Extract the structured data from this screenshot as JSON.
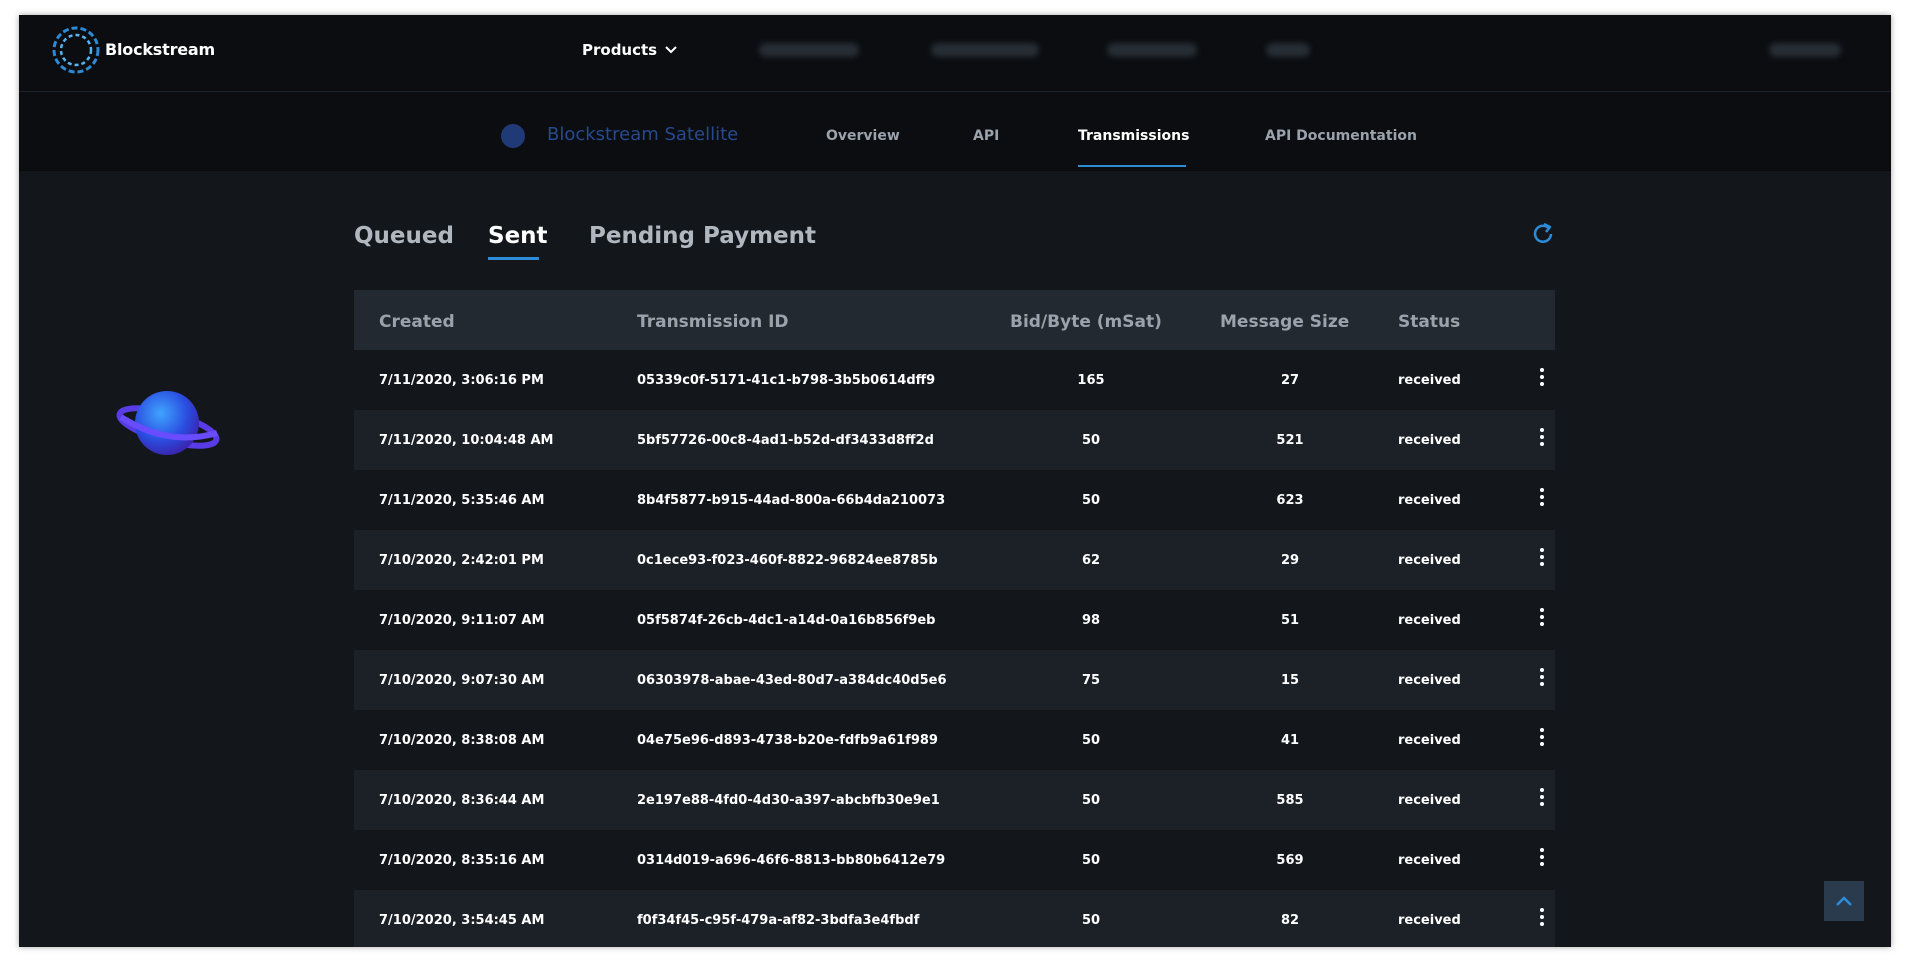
{
  "brand": {
    "name": "Blockstream"
  },
  "topnav": {
    "products_label": "Products"
  },
  "subnav": {
    "title": "Blockstream Satellite",
    "tabs": [
      "Overview",
      "API",
      "Transmissions",
      "API Documentation"
    ],
    "active_tab": "Transmissions"
  },
  "tabs": {
    "items": [
      "Queued",
      "Sent",
      "Pending Payment"
    ],
    "active": "Sent"
  },
  "table": {
    "headers": [
      "Created",
      "Transmission ID",
      "Bid/Byte (mSat)",
      "Message Size",
      "Status"
    ],
    "rows": [
      [
        "7/11/2020, 3:06:16 PM",
        "05339c0f-5171-41c1-b798-3b5b0614dff9",
        "165",
        "27",
        "received"
      ],
      [
        "7/11/2020, 10:04:48 AM",
        "5bf57726-00c8-4ad1-b52d-df3433d8ff2d",
        "50",
        "521",
        "received"
      ],
      [
        "7/11/2020, 5:35:46 AM",
        "8b4f5877-b915-44ad-800a-66b4da210073",
        "50",
        "623",
        "received"
      ],
      [
        "7/10/2020, 2:42:01 PM",
        "0c1ece93-f023-460f-8822-96824ee8785b",
        "62",
        "29",
        "received"
      ],
      [
        "7/10/2020, 9:11:07 AM",
        "05f5874f-26cb-4dc1-a14d-0a16b856f9eb",
        "98",
        "51",
        "received"
      ],
      [
        "7/10/2020, 9:07:30 AM",
        "06303978-abae-43ed-80d7-a384dc40d5e6",
        "75",
        "15",
        "received"
      ],
      [
        "7/10/2020, 8:38:08 AM",
        "04e75e96-d893-4738-b20e-fdfb9a61f989",
        "50",
        "41",
        "received"
      ],
      [
        "7/10/2020, 8:36:44 AM",
        "2e197e88-4fd0-4d30-a397-abcbfb30e9e1",
        "50",
        "585",
        "received"
      ],
      [
        "7/10/2020, 8:35:16 AM",
        "0314d019-a696-46f6-8813-bb80b6412e79",
        "50",
        "569",
        "received"
      ],
      [
        "7/10/2020, 3:54:45 AM",
        "f0f34f45-c95f-479a-af82-3bdfa3e4fbdf",
        "50",
        "82",
        "received"
      ]
    ]
  },
  "colors": {
    "accent": "#2d8cd8",
    "background": "#13171c",
    "nav_background": "#0b0d10"
  },
  "icons": {
    "logo": "blockstream-logo-icon",
    "refresh": "refresh-icon",
    "row_menu": "kebab-menu-icon",
    "scroll_top": "chevron-up-icon"
  }
}
